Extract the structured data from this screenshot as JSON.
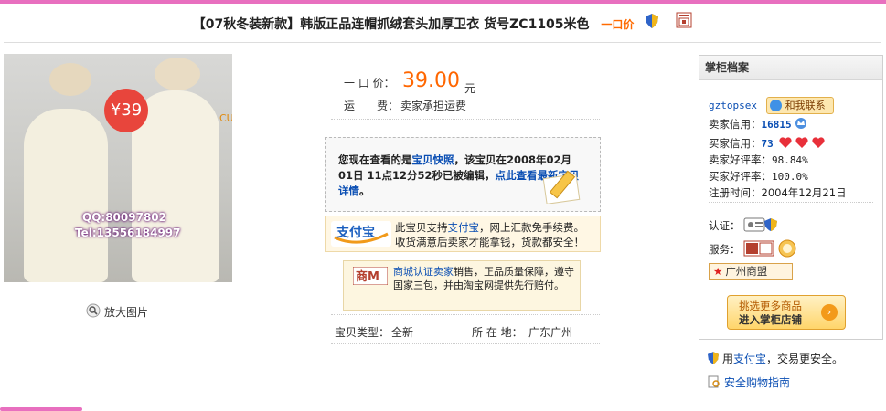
{
  "header": {
    "title": "【07秋冬装新款】韩版正品连帽抓绒套头加厚卫衣 货号ZC1105米色",
    "buy_label": "一口价"
  },
  "photo": {
    "price_tag": "¥39",
    "qq": "QQ:80097802",
    "tel": "Tel:13556184997",
    "corner_text": "CU"
  },
  "enlarge_label": "放大图片",
  "price": {
    "label": "一 口 价：",
    "value": "39.00",
    "unit": "元"
  },
  "shipping": {
    "label": "运　　费：",
    "value": "卖家承担运费"
  },
  "snapshot": {
    "prefix": "您现在查看的是",
    "link1": "宝贝快照",
    "middle": "，该宝贝在2008年02月01日 11点12分52秒已被编辑，",
    "link2": "点此查看最新宝贝详情",
    "suffix": "。"
  },
  "alipay": {
    "logo_text": "支付宝",
    "line1_prefix": "此宝贝支持",
    "line1_link": "支付宝",
    "line1_suffix": "，网上汇款免手续费。",
    "line2": "收货满意后卖家才能拿钱，货款都安全！"
  },
  "mall": {
    "logo_text": "商M",
    "link": "商城认证卖家",
    "text": "销售，正品质量保障，遵守国家三包，并由淘宝网提供先行赔付。"
  },
  "item_info": {
    "type_label": "宝贝类型：",
    "type_value": "全新",
    "location_label": "所 在 地：",
    "location_value": "广东广州"
  },
  "seller": {
    "header": "掌柜档案",
    "nick": "gztopsex",
    "contact_label": "和我联系",
    "seller_credit_label": "卖家信用：",
    "seller_credit_value": "16815",
    "buyer_credit_label": "买家信用：",
    "buyer_credit_value": "73",
    "seller_rate_label": "卖家好评率：",
    "seller_rate_value": "98.84%",
    "buyer_rate_label": "买家好评率：",
    "buyer_rate_value": "100.0%",
    "reg_label": "注册时间：",
    "reg_value": "2004年12月21日",
    "cert_label": "认证：",
    "service_label": "服务：",
    "league_label": "广州商盟",
    "enter_line1": "挑选更多商品",
    "enter_line2": "进入掌柜店铺"
  },
  "safety": {
    "use_prefix": "用",
    "use_link": "支付宝",
    "use_suffix": "，交易更安全。",
    "guide_link": "安全购物指南"
  },
  "colors": {
    "accent_pink": "#e86fbf",
    "price_orange": "#ff6600",
    "link_blue": "#0a4eb3"
  }
}
